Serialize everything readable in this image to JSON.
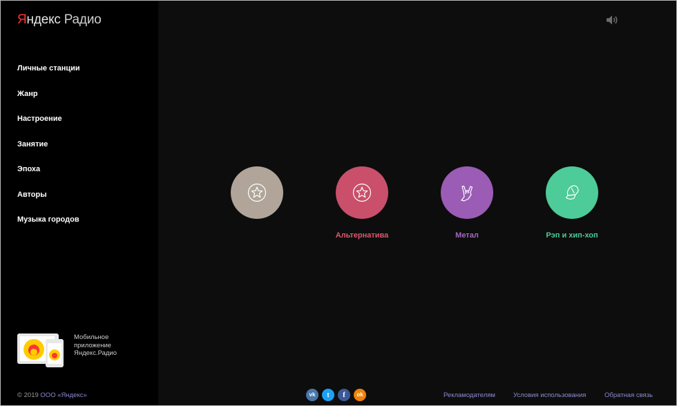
{
  "app": {
    "logo": {
      "brand_first": "Я",
      "brand_rest": "ндекс",
      "product": "Радио"
    }
  },
  "sidebar": {
    "items": [
      {
        "label": "Личные станции"
      },
      {
        "label": "Жанр"
      },
      {
        "label": "Настроение"
      },
      {
        "label": "Занятие"
      },
      {
        "label": "Эпоха"
      },
      {
        "label": "Авторы"
      },
      {
        "label": "Музыка городов"
      }
    ],
    "promo": {
      "line1": "Мобильное",
      "line2": "приложение",
      "line3": "Яндекс.Радио"
    }
  },
  "header": {
    "volume_icon": "speaker-icon"
  },
  "stations": [
    {
      "label": "",
      "icon": "star-icon",
      "color": "#b0a598"
    },
    {
      "label": "Альтернатива",
      "icon": "star-icon",
      "color": "#c94f6b"
    },
    {
      "label": "Метал",
      "icon": "rock-hand-icon",
      "color": "#9a5cb4"
    },
    {
      "label": "Рэп и хип-хоп",
      "icon": "cap-icon",
      "color": "#4dcb98"
    }
  ],
  "footer": {
    "copyright_prefix": "© 2019",
    "copyright_link": "ООО «Яндекс»",
    "social": [
      {
        "text": "vk",
        "icon": "vk-icon",
        "color": "#4a76a8"
      },
      {
        "text": "t",
        "icon": "twitter-icon",
        "color": "#1da1f2"
      },
      {
        "text": "f",
        "icon": "facebook-icon",
        "color": "#3b5998"
      },
      {
        "text": "ok",
        "icon": "odnoklassniki-icon",
        "color": "#ee8208"
      }
    ],
    "links": [
      {
        "label": "Рекламодателям"
      },
      {
        "label": "Условия использования"
      },
      {
        "label": "Обратная связь"
      }
    ]
  }
}
